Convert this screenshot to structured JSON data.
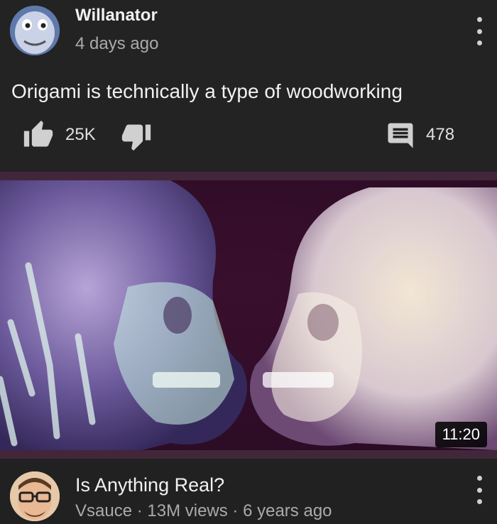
{
  "comment": {
    "username": "Willanator",
    "time_ago": "4 days ago",
    "text": "Origami is technically a type of woodworking",
    "likes": "25K",
    "replies": "478",
    "avatar_icon": "thomas-tank-engine-avatar",
    "like_icon": "thumbs-up-icon",
    "dislike_icon": "thumbs-down-icon",
    "reply_icon": "comment-icon",
    "menu_icon": "more-vertical-icon"
  },
  "video": {
    "duration": "11:20",
    "thumbnail_icon": "xray-skulls-kissing-thumbnail",
    "title": "Is Anything Real?",
    "channel": "Vsauce",
    "separator": " · ",
    "views": "13M views",
    "age": "6 years ago",
    "avatar_icon": "vsauce-host-avatar",
    "menu_icon": "more-vertical-icon"
  },
  "colors": {
    "background": "#212121",
    "text_primary": "#f1f1f1",
    "text_secondary": "#aaaaaa",
    "video_frame": "#42273a"
  }
}
